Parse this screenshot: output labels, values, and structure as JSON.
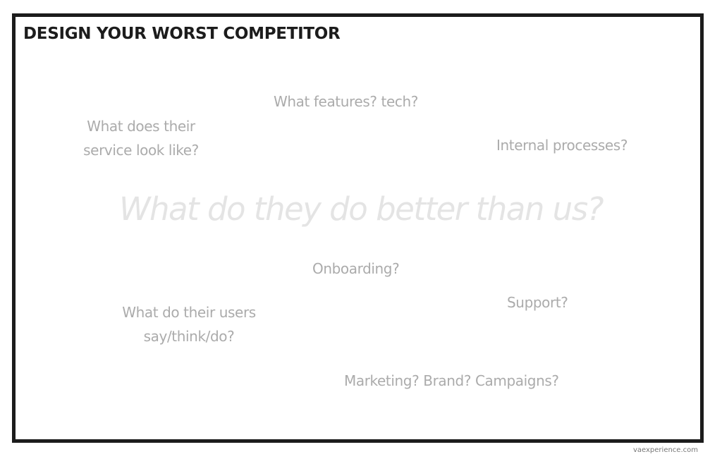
{
  "canvas": {
    "title": "DESIGN YOUR WORST COMPETITOR",
    "central_question": "What do they do better than us?",
    "prompts": {
      "features": "What features? tech?",
      "service_line1": "What does their",
      "service_line2": "service look like?",
      "internal": "Internal processes?",
      "onboarding": "Onboarding?",
      "support": "Support?",
      "users_line1": "What do their users",
      "users_line2": "say/think/do?",
      "marketing": "Marketing? Brand? Campaigns?"
    }
  },
  "footer": {
    "source": "vaexperience.com"
  },
  "colors": {
    "frame": "#1c1c1c",
    "title": "#1c1c1c",
    "prompt": "#ababab",
    "central_question": "#e4e4e4"
  }
}
